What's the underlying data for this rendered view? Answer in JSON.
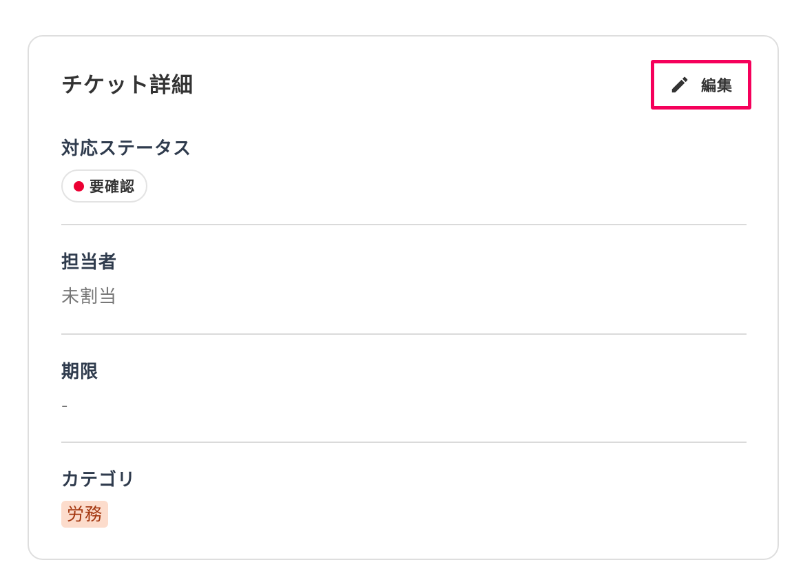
{
  "card": {
    "title": "チケット詳細",
    "edit_label": "編集",
    "edit_icon": "pencil-icon",
    "highlight_color": "#f5005b"
  },
  "fields": {
    "status": {
      "label": "対応ステータス",
      "value": "要確認",
      "dot_color": "#ec0033"
    },
    "assignee": {
      "label": "担当者",
      "value": "未割当"
    },
    "due_date": {
      "label": "期限",
      "value": "-"
    },
    "category": {
      "label": "カテゴリ",
      "value": "労務",
      "tag_color": "#fcdccc"
    }
  }
}
